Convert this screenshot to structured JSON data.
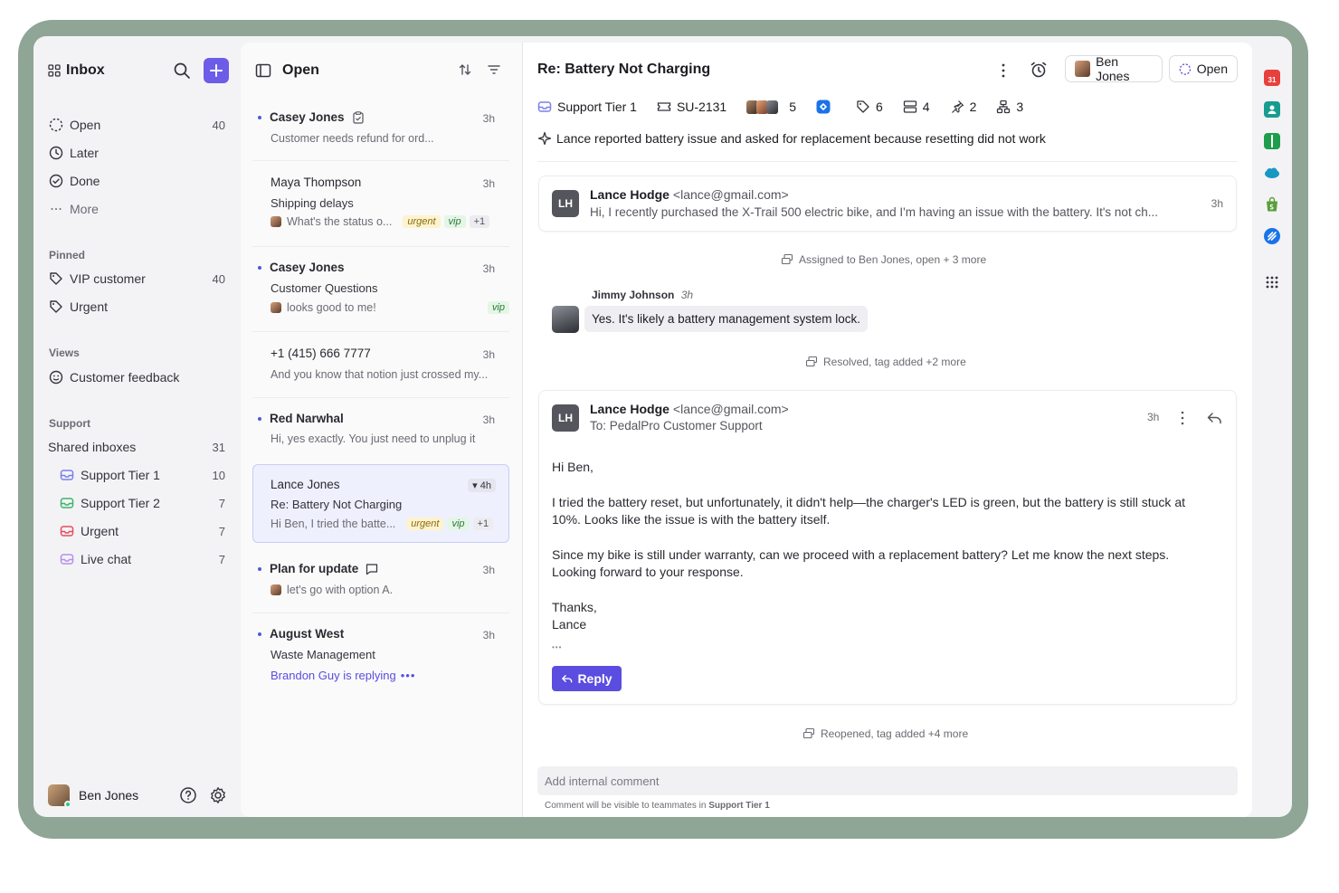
{
  "sidebar": {
    "title": "Inbox",
    "nav": [
      {
        "label": "Open",
        "count": "40",
        "icon": "circle-dashed-icon"
      },
      {
        "label": "Later",
        "count": "",
        "icon": "clock-icon"
      },
      {
        "label": "Done",
        "count": "",
        "icon": "check-circle-icon"
      },
      {
        "label": "More",
        "count": "",
        "icon": "more-icon"
      }
    ],
    "pinned_label": "Pinned",
    "pinned": [
      {
        "label": "VIP customer",
        "count": "40"
      },
      {
        "label": "Urgent",
        "count": ""
      }
    ],
    "views_label": "Views",
    "views": [
      {
        "label": "Customer feedback"
      }
    ],
    "support_label": "Support",
    "shared": {
      "label": "Shared inboxes",
      "count": "31"
    },
    "inboxes": [
      {
        "label": "Support Tier 1",
        "count": "10",
        "color": "#7b7fe8"
      },
      {
        "label": "Support Tier 2",
        "count": "7",
        "color": "#3fb36b"
      },
      {
        "label": "Urgent",
        "count": "7",
        "color": "#e64c5b"
      },
      {
        "label": "Live chat",
        "count": "7",
        "color": "#b68ee8"
      }
    ],
    "user": "Ben Jones"
  },
  "list": {
    "title": "Open",
    "items": [
      {
        "name": "Casey Jones",
        "time": "3h",
        "subject": "",
        "preview": "Customer needs refund for ord..."
      },
      {
        "name": "Maya Thompson",
        "time": "3h",
        "subject": "Shipping delays",
        "preview": "What's the status o...",
        "tags": [
          "urgent",
          "vip",
          "+1"
        ]
      },
      {
        "name": "Casey Jones",
        "time": "3h",
        "subject": "Customer Questions",
        "preview": "looks good to me!",
        "tags": [
          "vip"
        ]
      },
      {
        "name": "+1 (415) 666 7777",
        "time": "3h",
        "subject": "",
        "preview": "And you know that notion just crossed my..."
      },
      {
        "name": "Red Narwhal",
        "time": "3h",
        "subject": "",
        "preview": "Hi, yes exactly. You just need to unplug it"
      },
      {
        "name": "Lance Jones",
        "time": "4h",
        "subject": "Re: Battery Not Charging",
        "preview": "Hi Ben, I tried the batte...",
        "tags": [
          "urgent",
          "vip",
          "+1"
        ]
      },
      {
        "name": "Plan for update",
        "time": "3h",
        "subject": "",
        "preview": "let's go with option A."
      },
      {
        "name": "August West",
        "time": "3h",
        "subject": "Waste Management",
        "preview": "Brandon Guy is replying"
      }
    ]
  },
  "thread": {
    "title": "Re: Battery Not Charging",
    "assignee": "Ben Jones",
    "status": "Open",
    "meta": {
      "inbox": "Support Tier 1",
      "ticket": "SU-2131",
      "participants": "5",
      "tags": "6",
      "fields": "4",
      "pins": "2",
      "links": "3"
    },
    "summary": "Lance reported battery issue and asked for replacement because resetting did not work",
    "msg1": {
      "initials": "LH",
      "name": "Lance Hodge",
      "email": "<lance@gmail.com>",
      "preview": "Hi, I recently purchased the X-Trail 500 electric bike, and I'm having an issue with the battery. It's not ch...",
      "time": "3h"
    },
    "event1": "Assigned to Ben Jones, open + 3 more",
    "chat": {
      "name": "Jimmy Johnson",
      "time": "3h",
      "text": "Yes. It's likely a battery management system lock."
    },
    "event2": "Resolved, tag added +2 more",
    "msg2": {
      "initials": "LH",
      "name": "Lance Hodge",
      "email": "<lance@gmail.com>",
      "to": "To: PedalPro Customer Support",
      "time": "3h",
      "greeting": "Hi Ben,",
      "p1a": "I tried the battery reset, but unfortunately, it didn't help—the charger's LED is green, but the battery is still stuck at",
      "p1b": "10%. Looks like the issue is with the battery itself.",
      "p2a": "Since my bike is still under warranty, can we proceed with a replacement battery? Let me know the next steps.",
      "p2b": "Looking forward to your response.",
      "thanks": "Thanks,",
      "sig": "Lance",
      "ellipsis": "•••",
      "reply": "Reply"
    },
    "event3": "Reopened, tag added +4 more",
    "comment_placeholder": "Add internal comment",
    "comment_hint": "Comment will be visible to teammates in",
    "comment_hint_bold": "Support Tier 1"
  },
  "rail": {
    "calendar_day": "31"
  },
  "colors": {
    "accent": "#6c5ce7",
    "frame": "#8fa596"
  }
}
